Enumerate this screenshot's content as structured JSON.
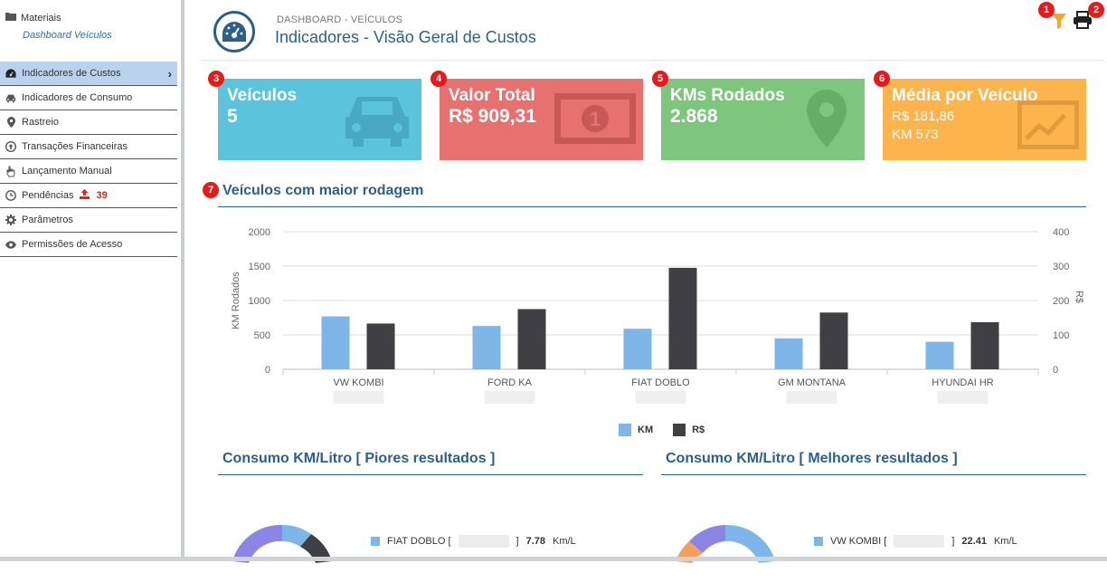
{
  "sidebar": {
    "top_label": "Materiais",
    "sub_label": "Dashboard Veículos",
    "items": [
      {
        "label": "Indicadores de Custos",
        "icon": "dashboard-icon",
        "active": true
      },
      {
        "label": "Indicadores de Consumo",
        "icon": "car-icon"
      },
      {
        "label": "Rastreio",
        "icon": "map-marker-icon"
      },
      {
        "label": "Transações Financeiras",
        "icon": "circle-arrow-icon"
      },
      {
        "label": "Lançamento Manual",
        "icon": "hand-pointer-icon"
      },
      {
        "label": "Pendências",
        "icon": "clock-icon",
        "count": "39"
      },
      {
        "label": "Parâmetros",
        "icon": "gear-icon"
      },
      {
        "label": "Permissões de Acesso",
        "icon": "eye-icon"
      }
    ]
  },
  "header": {
    "breadcrumb": "DASHBOARD - VEÍCULOS",
    "title": "Indicadores - Visão Geral de Custos"
  },
  "toolbar": {
    "filter_badge": "1",
    "print_badge": "2"
  },
  "cards": [
    {
      "badge": "3",
      "title": "Veículos",
      "value": "5",
      "color": "#5bc4dc",
      "icon": "car-icon"
    },
    {
      "badge": "4",
      "title": "Valor Total",
      "value": "R$ 909,31",
      "color": "#e6716f",
      "icon": "money-icon"
    },
    {
      "badge": "5",
      "title": "KMs Rodados",
      "value": "2.868",
      "color": "#7ec67e",
      "icon": "map-marker-icon"
    },
    {
      "badge": "6",
      "title": "Média por Veículo",
      "line1": "R$ 181,86",
      "line2": "KM 573",
      "color": "#fdb44d",
      "icon": "line-chart-icon"
    }
  ],
  "section_main": {
    "badge": "7",
    "title": "Veículos com maior rodagem"
  },
  "chart_data": {
    "type": "bar",
    "categories": [
      "VW KOMBI",
      "FORD KA",
      "FIAT DOBLO",
      "GM MONTANA",
      "HYUNDAI HR"
    ],
    "series": [
      {
        "name": "KM",
        "axis": "left",
        "color": "#7fb6ea",
        "values": [
          770,
          630,
          590,
          450,
          400
        ]
      },
      {
        "name": "R$",
        "axis": "right",
        "color": "#3f3f44",
        "values": [
          133,
          175,
          295,
          165,
          137
        ]
      }
    ],
    "ylabel": "KM Rodados",
    "y2label": "R$",
    "ylim": [
      0,
      2000
    ],
    "y2lim": [
      0,
      400
    ],
    "yticks": [
      "0",
      "500",
      "1000",
      "1500",
      "2000"
    ],
    "y2ticks": [
      "0",
      "100",
      "200",
      "300",
      "400"
    ],
    "legend": "bottom-center",
    "grid": true
  },
  "consumo_piores": {
    "title": "Consumo KM/Litro [ Piores resultados ]",
    "items": [
      {
        "vehicle": "FIAT DOBLO [",
        "value": "7.78",
        "unit": "Km/L",
        "color": "#7fb6ea"
      }
    ]
  },
  "consumo_melhores": {
    "title": "Consumo KM/Litro [ Melhores resultados ]",
    "items": [
      {
        "vehicle": "VW KOMBI [",
        "value": "22.41",
        "unit": "Km/L",
        "color": "#7fb6ea"
      }
    ]
  }
}
